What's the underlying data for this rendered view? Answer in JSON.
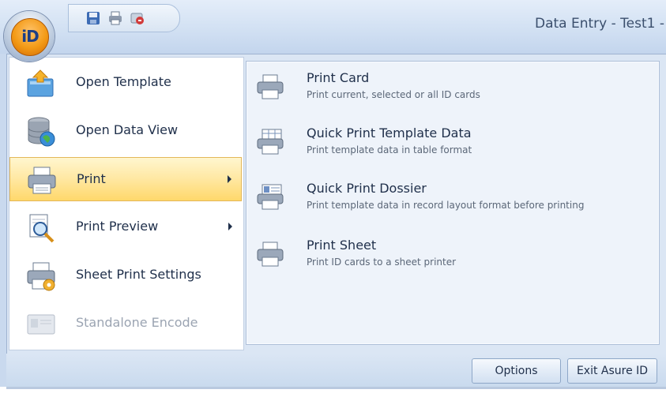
{
  "window": {
    "title": "Data Entry - Test1 -",
    "app_button_text": "iD"
  },
  "quick_access_toolbar": [
    {
      "icon": "save-icon"
    },
    {
      "icon": "printer-icon"
    },
    {
      "icon": "encode-icon"
    }
  ],
  "left_menu": {
    "items": [
      {
        "label": "Open Template",
        "icon": "open-template-icon",
        "has_submenu": false,
        "active": false,
        "enabled": true
      },
      {
        "label": "Open Data View",
        "icon": "database-globe-icon",
        "has_submenu": false,
        "active": false,
        "enabled": true
      },
      {
        "label": "Print",
        "icon": "printer-icon",
        "has_submenu": true,
        "active": true,
        "enabled": true
      },
      {
        "label": "Print Preview",
        "icon": "print-preview-icon",
        "has_submenu": true,
        "active": false,
        "enabled": true
      },
      {
        "label": "Sheet Print Settings",
        "icon": "sheet-print-settings-icon",
        "has_submenu": false,
        "active": false,
        "enabled": true
      },
      {
        "label": "Standalone Encode",
        "icon": "card-encode-icon",
        "has_submenu": false,
        "active": false,
        "enabled": false
      }
    ]
  },
  "submenu": {
    "items": [
      {
        "title": "Print Card",
        "description": "Print current, selected or all ID cards",
        "icon": "printer-icon"
      },
      {
        "title": "Quick Print Template Data",
        "description": "Print template data in table format",
        "icon": "print-table-icon"
      },
      {
        "title": "Quick Print Dossier",
        "description": "Print template data in record layout format before printing",
        "icon": "print-dossier-icon"
      },
      {
        "title": "Print Sheet",
        "description": "Print ID cards to a sheet printer",
        "icon": "printer-icon"
      }
    ]
  },
  "footer": {
    "options_label": "Options",
    "exit_label": "Exit Asure ID"
  },
  "colors": {
    "active_highlight": "#ffd86b",
    "frame": "#dbe6f4",
    "orb": "#f39a16"
  }
}
